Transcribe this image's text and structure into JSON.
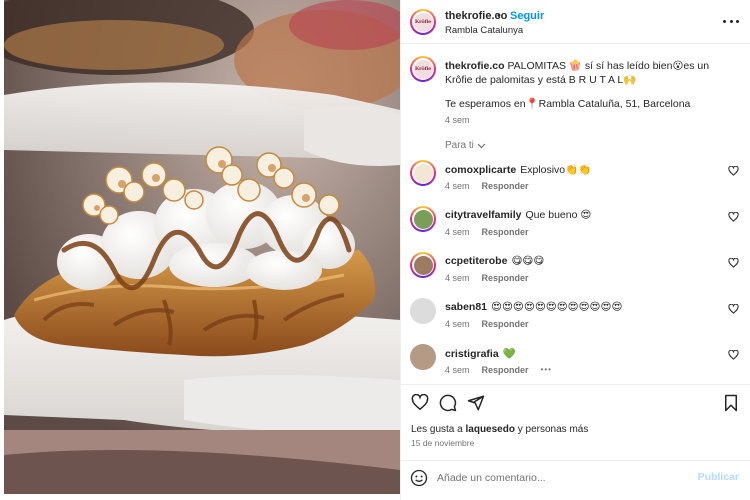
{
  "post": {
    "username": "thekrofie.co",
    "dot": "•",
    "follow_label": "Seguir",
    "location": "Rambla Catalunya",
    "avatar_text": "Krôfie"
  },
  "caption": {
    "username": "thekrofie.co",
    "text": "PALOMITAS 🍿 sí sí has leído bien😮es un Krôfie de palomitas y está B R U T A L🙌",
    "line2": "Te esperamos en📍Rambla Cataluña, 51, Barcelona",
    "time": "4 sem",
    "translation_label": "Para ti"
  },
  "comments": [
    {
      "username": "comoxplicarte",
      "text": "Explosivo👏👏",
      "time": "4 sem",
      "reply": "Responder"
    },
    {
      "username": "citytravelfamily",
      "text": "Que bueno 😍",
      "time": "4 sem",
      "reply": "Responder"
    },
    {
      "username": "ccpetiterobe",
      "text": "😋😋😋",
      "time": "4 sem",
      "reply": "Responder"
    },
    {
      "username": "saben81",
      "text": "😍😍😍😍😍😍😍😍😍😍😍😍",
      "time": "4 sem",
      "reply": "Responder"
    },
    {
      "username": "cristigrafia",
      "text": "💚",
      "time": "4 sem",
      "reply": "Responder",
      "more": "•••"
    }
  ],
  "footer": {
    "likes_prefix": "Les gusta a",
    "likes_user": "laquesedo",
    "likes_suffix": "y personas más",
    "date": "15 de noviembre",
    "comment_placeholder": "Añade un comentario...",
    "publish_label": "Publicar"
  },
  "icons": {
    "more": "more-options-icon",
    "like": "heart-icon",
    "comment": "comment-icon",
    "share": "share-icon",
    "save": "bookmark-icon",
    "emoji": "emoji-icon",
    "chevron": "chevron-down-icon"
  },
  "colors": {
    "accent": "#0095f6",
    "publish_disabled": "#b3dbff",
    "secondary_text": "#737373",
    "primary_text": "#262626",
    "divider": "#efefef"
  }
}
